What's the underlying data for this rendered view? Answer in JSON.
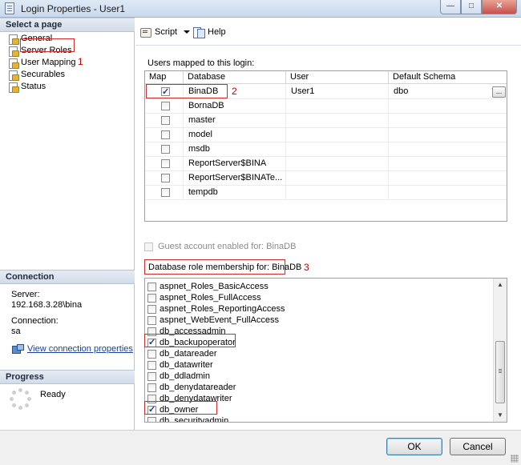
{
  "window": {
    "title": "Login Properties - User1"
  },
  "left": {
    "select_page_header": "Select a page",
    "pages": [
      "General",
      "Server Roles",
      "User Mapping",
      "Securables",
      "Status"
    ],
    "connection_header": "Connection",
    "server_label": "Server:",
    "server_value": "192.168.3.28\\bina",
    "connection_label": "Connection:",
    "connection_value": "sa",
    "view_conn_link": "View connection properties",
    "progress_header": "Progress",
    "progress_status": "Ready"
  },
  "annotations": {
    "n1": "1",
    "n2": "2",
    "n3": "3"
  },
  "toolbar": {
    "script_label": "Script",
    "help_label": "Help"
  },
  "users_mapped": {
    "label": "Users mapped to this login:",
    "columns": [
      "Map",
      "Database",
      "User",
      "Default Schema"
    ],
    "rows": [
      {
        "checked": true,
        "database": "BinaDB",
        "user": "User1",
        "schema": "dbo"
      },
      {
        "checked": false,
        "database": "BornaDB",
        "user": "",
        "schema": ""
      },
      {
        "checked": false,
        "database": "master",
        "user": "",
        "schema": ""
      },
      {
        "checked": false,
        "database": "model",
        "user": "",
        "schema": ""
      },
      {
        "checked": false,
        "database": "msdb",
        "user": "",
        "schema": ""
      },
      {
        "checked": false,
        "database": "ReportServer$BINA",
        "user": "",
        "schema": ""
      },
      {
        "checked": false,
        "database": "ReportServer$BINATe...",
        "user": "",
        "schema": ""
      },
      {
        "checked": false,
        "database": "tempdb",
        "user": "",
        "schema": ""
      }
    ],
    "ellipsis": "..."
  },
  "guest": {
    "label": "Guest account enabled for: BinaDB",
    "checked": false
  },
  "roles": {
    "label": "Database role membership for: BinaDB",
    "items": [
      {
        "name": "aspnet_Roles_BasicAccess",
        "checked": false
      },
      {
        "name": "aspnet_Roles_FullAccess",
        "checked": false
      },
      {
        "name": "aspnet_Roles_ReportingAccess",
        "checked": false
      },
      {
        "name": "aspnet_WebEvent_FullAccess",
        "checked": false
      },
      {
        "name": "db_accessadmin",
        "checked": false
      },
      {
        "name": "db_backupoperator",
        "checked": true
      },
      {
        "name": "db_datareader",
        "checked": false
      },
      {
        "name": "db_datawriter",
        "checked": false
      },
      {
        "name": "db_ddladmin",
        "checked": false
      },
      {
        "name": "db_denydatareader",
        "checked": false
      },
      {
        "name": "db_denydatawriter",
        "checked": false
      },
      {
        "name": "db_owner",
        "checked": true
      },
      {
        "name": "db_securityadmin",
        "checked": false
      }
    ]
  },
  "buttons": {
    "ok": "OK",
    "cancel": "Cancel"
  }
}
